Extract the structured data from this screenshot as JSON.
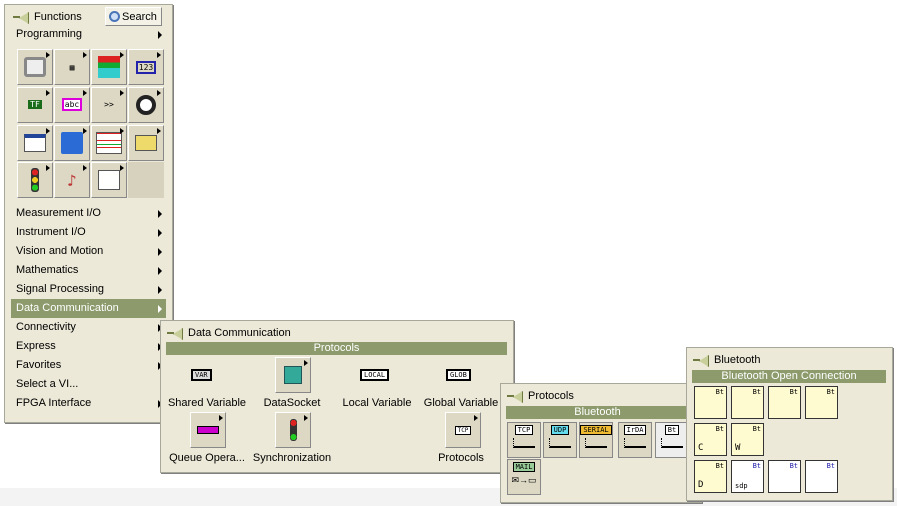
{
  "functions_palette": {
    "title": "Functions",
    "search_label": "Search",
    "category": "Programming",
    "grid_icons": [
      "structures",
      "array",
      "cluster-class-variant",
      "numeric",
      "boolean",
      "string",
      "comparison",
      "timing",
      "dialog-ui",
      "file-io",
      "waveform",
      "application-control",
      "synchronization",
      "graphics-sound",
      "report-generation"
    ],
    "items": [
      "Measurement I/O",
      "Instrument I/O",
      "Vision and Motion",
      "Mathematics",
      "Signal Processing",
      "Data Communication",
      "Connectivity",
      "Express",
      "Favorites",
      "Select a VI...",
      "FPGA Interface"
    ],
    "selected": "Data Communication"
  },
  "data_comm": {
    "title": "Data Communication",
    "header": "Protocols",
    "items": [
      {
        "label": "Shared Variable",
        "tag": "VAR"
      },
      {
        "label": "DataSocket",
        "tag": ""
      },
      {
        "label": "Local Variable",
        "tag": "LOCAL"
      },
      {
        "label": "Global Variable",
        "tag": "GLOB"
      },
      {
        "label": "Queue Opera...",
        "tag": ""
      },
      {
        "label": "Synchronization",
        "tag": ""
      },
      {
        "label": "Protocols",
        "tag": "TCP"
      }
    ]
  },
  "protocols": {
    "title": "Protocols",
    "header": "Bluetooth",
    "tags": [
      "TCP",
      "UDP",
      "SERIAL",
      "IrDA",
      "Bt",
      "MAIL"
    ]
  },
  "bluetooth": {
    "title": "Bluetooth",
    "header": "Bluetooth Open Connection",
    "tag": "Bt",
    "letters": [
      "C",
      "W",
      "D",
      "sdp"
    ]
  }
}
